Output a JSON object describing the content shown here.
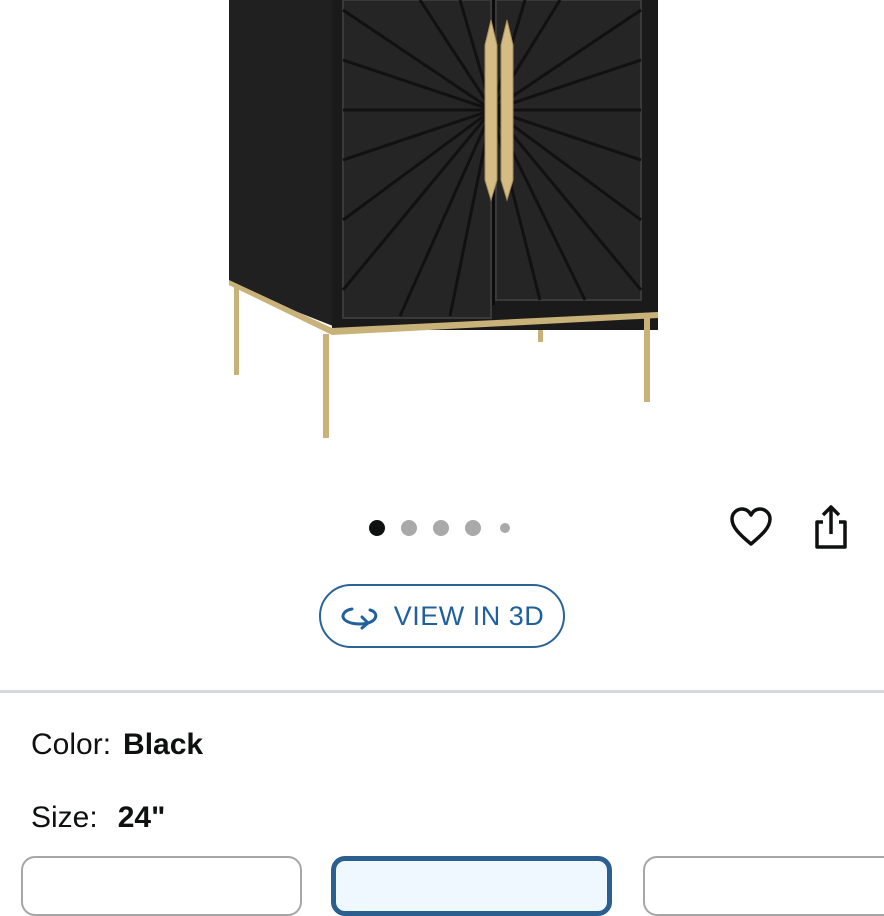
{
  "gallery": {
    "image_alt": "black cabinet with starburst doors",
    "dots": [
      {
        "state": "active"
      },
      {
        "state": "inactive"
      },
      {
        "state": "inactive"
      },
      {
        "state": "inactive"
      },
      {
        "state": "inactive-small"
      }
    ],
    "icons": {
      "wishlist": "heart-icon",
      "share": "share-icon"
    }
  },
  "view3d": {
    "label": "VIEW IN 3D",
    "icon": "rotate-3d-icon"
  },
  "variations": {
    "color": {
      "label": "Color:",
      "value": "Black"
    },
    "size": {
      "label": "Size:",
      "value": "24\""
    },
    "size_options": [
      {
        "state": "unselected"
      },
      {
        "state": "selected"
      },
      {
        "state": "unselected"
      }
    ]
  },
  "colors": {
    "accent": "#2a6496",
    "gold": "#c9b27a",
    "cabinet": "#1e1e1e"
  }
}
